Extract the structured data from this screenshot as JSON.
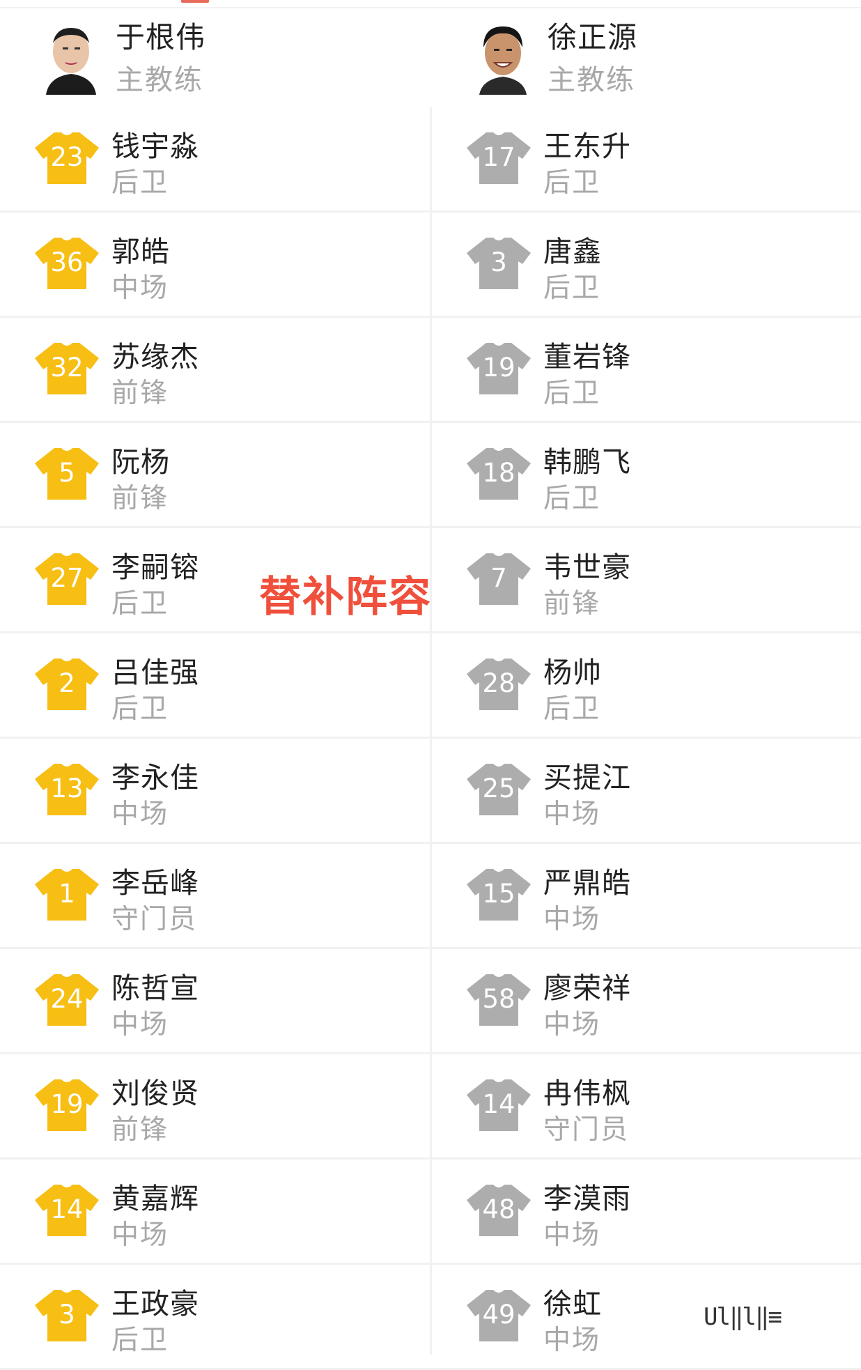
{
  "coaches": [
    {
      "name": "于根伟",
      "role": "主教练"
    },
    {
      "name": "徐正源",
      "role": "主教练"
    }
  ],
  "substitutes_title": "替补阵容",
  "colors": {
    "home_shirt": "#f7be13",
    "away_shirt": "#adadad",
    "title_red": "#ef4f3b"
  },
  "rows": [
    {
      "left": {
        "number": "23",
        "name": "钱宇淼",
        "position": "后卫"
      },
      "right": {
        "number": "17",
        "name": "王东升",
        "position": "后卫"
      }
    },
    {
      "left": {
        "number": "36",
        "name": "郭皓",
        "position": "中场"
      },
      "right": {
        "number": "3",
        "name": "唐鑫",
        "position": "后卫"
      }
    },
    {
      "left": {
        "number": "32",
        "name": "苏缘杰",
        "position": "前锋"
      },
      "right": {
        "number": "19",
        "name": "董岩锋",
        "position": "后卫"
      }
    },
    {
      "left": {
        "number": "5",
        "name": "阮杨",
        "position": "前锋"
      },
      "right": {
        "number": "18",
        "name": "韩鹏飞",
        "position": "后卫"
      }
    },
    {
      "left": {
        "number": "27",
        "name": "李嗣镕",
        "position": "后卫"
      },
      "right": {
        "number": "7",
        "name": "韦世豪",
        "position": "前锋"
      }
    },
    {
      "left": {
        "number": "2",
        "name": "吕佳强",
        "position": "后卫"
      },
      "right": {
        "number": "28",
        "name": "杨帅",
        "position": "后卫"
      }
    },
    {
      "left": {
        "number": "13",
        "name": "李永佳",
        "position": "中场"
      },
      "right": {
        "number": "25",
        "name": "买提江",
        "position": "中场"
      }
    },
    {
      "left": {
        "number": "1",
        "name": "李岳峰",
        "position": "守门员"
      },
      "right": {
        "number": "15",
        "name": "严鼎皓",
        "position": "中场"
      }
    },
    {
      "left": {
        "number": "24",
        "name": "陈哲宣",
        "position": "中场"
      },
      "right": {
        "number": "58",
        "name": "廖荣祥",
        "position": "中场"
      }
    },
    {
      "left": {
        "number": "19",
        "name": "刘俊贤",
        "position": "前锋"
      },
      "right": {
        "number": "14",
        "name": "冉伟枫",
        "position": "守门员"
      }
    },
    {
      "left": {
        "number": "14",
        "name": "黄嘉辉",
        "position": "中场"
      },
      "right": {
        "number": "48",
        "name": "李漠雨",
        "position": "中场"
      }
    },
    {
      "left": {
        "number": "3",
        "name": "王政豪",
        "position": "后卫"
      },
      "right": {
        "number": "49",
        "name": "徐虹",
        "position": "中场"
      }
    }
  ],
  "watermark": "Ul‖l‖≡"
}
